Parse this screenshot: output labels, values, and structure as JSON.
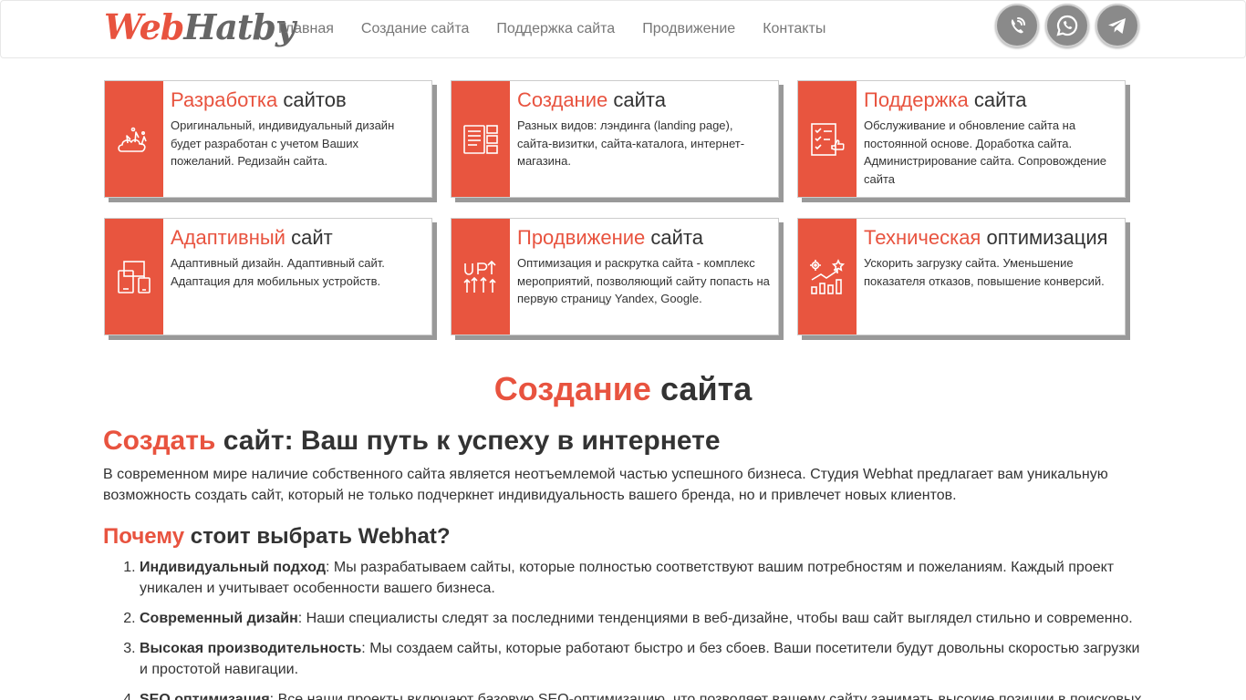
{
  "logo": {
    "part1": "Web",
    "part2": "Hatby"
  },
  "nav": [
    "Главная",
    "Создание сайта",
    "Поддержка сайта",
    "Продвижение",
    "Контакты"
  ],
  "messengers": [
    "viber-icon",
    "whatsapp-icon",
    "telegram-icon"
  ],
  "colors": {
    "accent": "#e8533f",
    "icon_bg": "#e8553f",
    "messenger_bg": "#8a8a8a"
  },
  "cards": [
    {
      "icon": "rocket-cloud-icon",
      "accent": "Разработка",
      "rest": " сайтов",
      "text": "Оригинальный, индивидуальный дизайн будет разработан с учетом Ваших пожеланий. Редизайн сайта."
    },
    {
      "icon": "layout-blocks-icon",
      "accent": "Создание",
      "rest": " сайта",
      "text": "Разных видов: лэндинга (landing page), сайта-визитки, сайта-каталога, интернет-магазина."
    },
    {
      "icon": "checklist-thumbs-up-icon",
      "accent": "Поддержка",
      "rest": " сайта",
      "text": "Обслуживание и обновление сайта на постоянной основе. Доработка сайта. Администрирование сайта. Сопровождение сайта"
    },
    {
      "icon": "devices-icon",
      "accent": "Адаптивный",
      "rest": " сайт",
      "text": "Адаптивный дизайн. Адаптивный сайт. Адаптация для мобильных устройств."
    },
    {
      "icon": "up-arrows-icon",
      "accent": "Продвижение",
      "rest": " сайта",
      "text": "Оптимизация и раскрутка сайта - комплекс мероприятий, позволяющий сайту попасть на первую страницу Yandex, Google."
    },
    {
      "icon": "growth-chart-gears-icon",
      "accent": "Техническая",
      "rest": " оптимизация",
      "text": "Ускорить загрузку сайта. Уменьшение показателя отказов, повышение конверсий."
    }
  ],
  "section_title": {
    "accent": "Создание",
    "rest": " сайта"
  },
  "h2": {
    "accent": "Создать",
    "rest": " сайт: Ваш путь к успеху в интернете"
  },
  "intro": "В современном мире наличие собственного сайта является неотъемлемой частью успешного бизнеса. Студия Webhat предлагает вам уникальную возможность создать сайт, который не только подчеркнет индивидуальность вашего бренда, но и привлечет новых клиентов.",
  "h3": {
    "accent": "Почему",
    "rest": " стоит выбрать Webhat?"
  },
  "reasons": [
    {
      "bold": "Индивидуальный подход",
      "text": ": Мы разрабатываем сайты, которые полностью соответствуют вашим потребностям и пожеланиям. Каждый проект уникален и учитывает особенности вашего бизнеса."
    },
    {
      "bold": "Современный дизайн",
      "text": ": Наши специалисты следят за последними тенденциями в веб-дизайне, чтобы ваш сайт выглядел стильно и современно."
    },
    {
      "bold": "Высокая производительность",
      "text": ": Мы создаем сайты, которые работают быстро и без сбоев. Ваши посетители будут довольны скоростью загрузки и простотой навигации."
    },
    {
      "bold": "SEO оптимизация",
      "text": ": Все наши проекты включают базовую SEO-оптимизацию, что позволяет вашему сайту занимать высокие позиции в поисковых"
    }
  ]
}
